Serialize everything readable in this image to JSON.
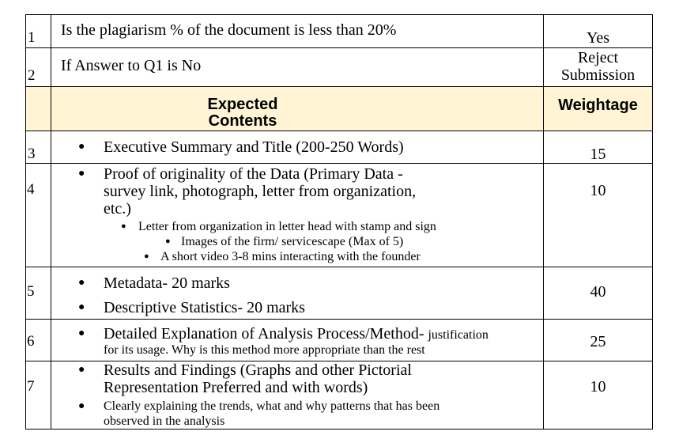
{
  "rows": {
    "r1": {
      "num": "1",
      "text": "Is the plagiarism % of the document is less than 20%",
      "weight": "Yes"
    },
    "r2": {
      "num": "2",
      "text": "If Answer to Q1 is No",
      "weight_line1": "Reject",
      "weight_line2": "Submission"
    },
    "header": {
      "content_line1": "Expected",
      "content_line2": "Contents",
      "weight": "Weightage"
    },
    "r3": {
      "num": "3",
      "bullet": "Executive Summary and Title (200-250 Words)",
      "weight": "15"
    },
    "r4": {
      "num": "4",
      "bullet_l1": "Proof of originality of the Data (Primary Data -",
      "bullet_l2": "survey link, photograph, letter from organization,",
      "bullet_l3": "etc.)",
      "sub1": "Letter from organization in letter head with stamp and sign",
      "sub2": "Images of the firm/ servicescape (Max of 5)",
      "sub3": "A short video 3-8 mins interacting with the founder",
      "weight": "10"
    },
    "r5": {
      "num": "5",
      "bullet1": "Metadata- 20 marks",
      "bullet2": "Descriptive Statistics- 20 marks",
      "weight": "40"
    },
    "r6": {
      "num": "6",
      "bullet_main": "Detailed Explanation of Analysis Process/Method-",
      "bullet_small": "justification",
      "bullet_l2": "for its usage. Why is this method more appropriate than the rest",
      "weight": "25"
    },
    "r7": {
      "num": "7",
      "bullet_l1": "Results and Findings (Graphs and other Pictorial",
      "bullet_l2": "Representation Preferred and with words)",
      "sub_l1": "Clearly explaining the trends, what and why patterns that has been",
      "sub_l2": "observed in the analysis",
      "weight": "10"
    }
  }
}
